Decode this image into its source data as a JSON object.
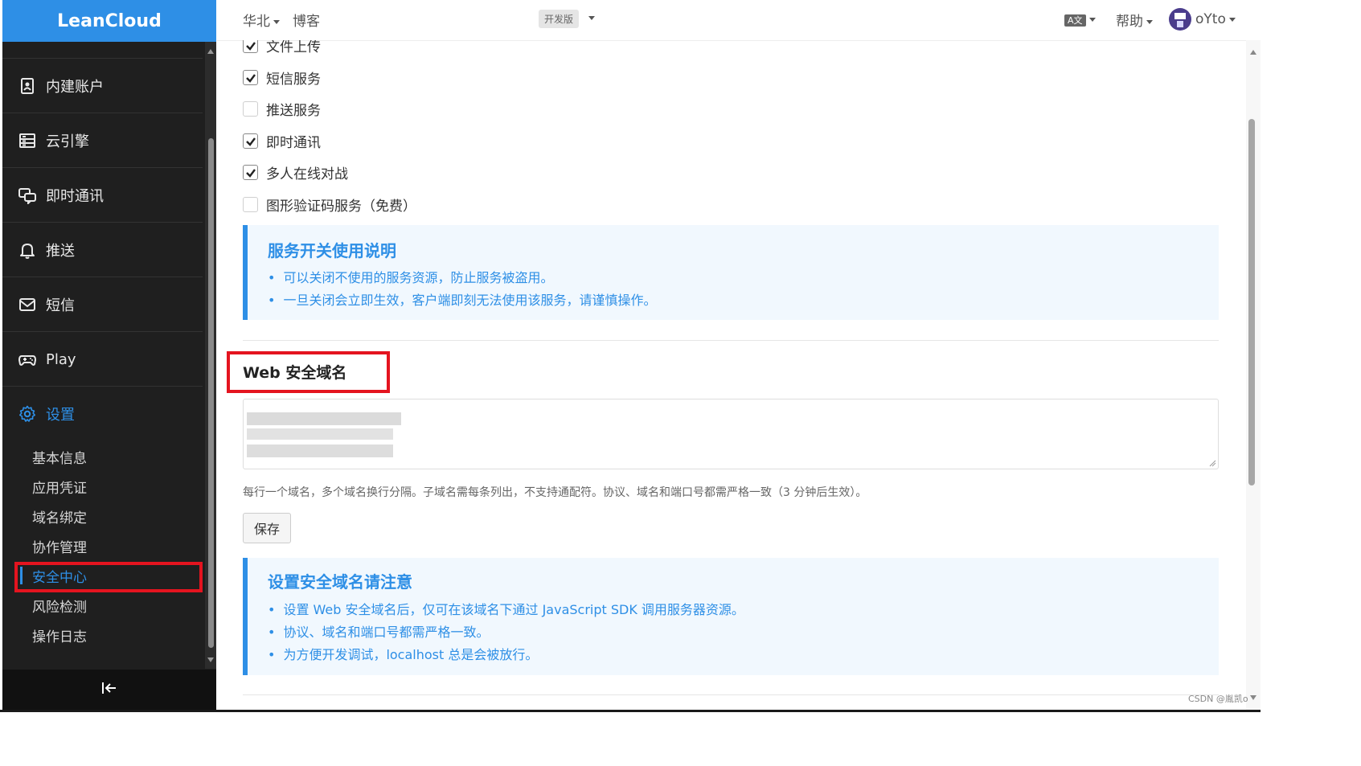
{
  "brand": "LeanCloud",
  "topbar": {
    "region": "华北",
    "app_name": "博客",
    "plan_badge": "开发版",
    "language_icon": "A文",
    "help": "帮助",
    "user": "oYto"
  },
  "sidebar": {
    "items": [
      {
        "label": "内建账户",
        "icon": "id-card-icon"
      },
      {
        "label": "云引擎",
        "icon": "server-icon"
      },
      {
        "label": "即时通讯",
        "icon": "chat-icon"
      },
      {
        "label": "推送",
        "icon": "bell-icon"
      },
      {
        "label": "短信",
        "icon": "mail-icon"
      },
      {
        "label": "Play",
        "icon": "gamepad-icon"
      },
      {
        "label": "设置",
        "icon": "gear-icon"
      }
    ],
    "sub_items": [
      "基本信息",
      "应用凭证",
      "域名绑定",
      "协作管理",
      "安全中心",
      "风险检测",
      "操作日志"
    ],
    "active_sub": "安全中心"
  },
  "services": [
    {
      "label": "文件上传",
      "checked": true
    },
    {
      "label": "短信服务",
      "checked": true
    },
    {
      "label": "推送服务",
      "checked": false
    },
    {
      "label": "即时通讯",
      "checked": true
    },
    {
      "label": "多人在线对战",
      "checked": true
    },
    {
      "label": "图形验证码服务（免费）",
      "checked": false
    }
  ],
  "service_note": {
    "title": "服务开关使用说明",
    "lines": [
      "可以关闭不使用的服务资源，防止服务被盗用。",
      "一旦关闭会立即生效，客户端即刻无法使用该服务，请谨慎操作。"
    ]
  },
  "web_domain": {
    "title": "Web 安全域名",
    "help": "每行一个域名，多个域名换行分隔。子域名需每条列出，不支持通配符。协议、域名和端口号都需严格一致（3 分钟后生效）。",
    "save": "保存"
  },
  "domain_note": {
    "title": "设置安全域名请注意",
    "lines": [
      "设置 Web 安全域名后，仅可在该域名下通过 JavaScript SDK 调用服务器资源。",
      "协议、域名和端口号都需严格一致。",
      "为方便开发调试，localhost 总是会被放行。"
    ]
  },
  "watermark": "CSDN @胤凯o",
  "colors": {
    "accent": "#2e8fe6",
    "sidebar": "#1f1f1f",
    "highlight_box": "#e4141f"
  }
}
